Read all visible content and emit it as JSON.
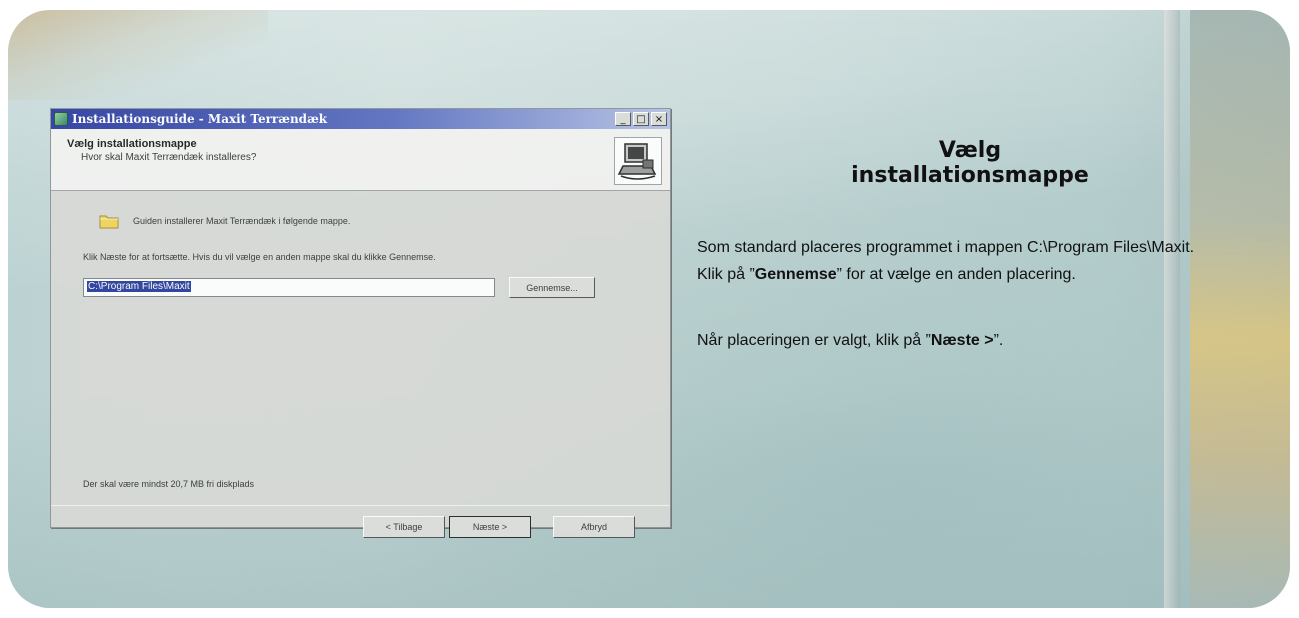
{
  "window": {
    "title": "Installationsguide - Maxit Terrændæk",
    "minimize": "_",
    "maximize": "□",
    "close": "×"
  },
  "header": {
    "title": "Vælg installationsmappe",
    "subtitle": "Hvor skal Maxit Terrændæk installeres?"
  },
  "content": {
    "info": "Guiden installerer Maxit Terrændæk i følgende mappe.",
    "instruction": "Klik Næste for at fortsætte. Hvis du vil vælge en anden mappe skal du klikke Gennemse.",
    "path_value": "C:\\Program Files\\Maxit",
    "browse_label": "Gennemse...",
    "disk_space": "Der skal være mindst 20,7 MB fri diskplads"
  },
  "buttons": {
    "back": "< Tilbage",
    "next": "Næste >",
    "cancel": "Afbryd"
  },
  "panel": {
    "heading_line1": "Vælg",
    "heading_line2": "installationsmappe",
    "p1_part1": "Som standard placeres programmet i mappen C:\\Program Files\\Maxit. Klik på ”",
    "p1_bold": "Gennemse",
    "p1_part2": "” for at vælge en anden placering.",
    "p2_part1": "Når placeringen er valgt, klik på ”",
    "p2_bold": "Næste >",
    "p2_part2": "”."
  },
  "icons": {
    "app": "installer-app-icon",
    "setup": "computer-setup-icon",
    "folder": "folder-icon"
  }
}
